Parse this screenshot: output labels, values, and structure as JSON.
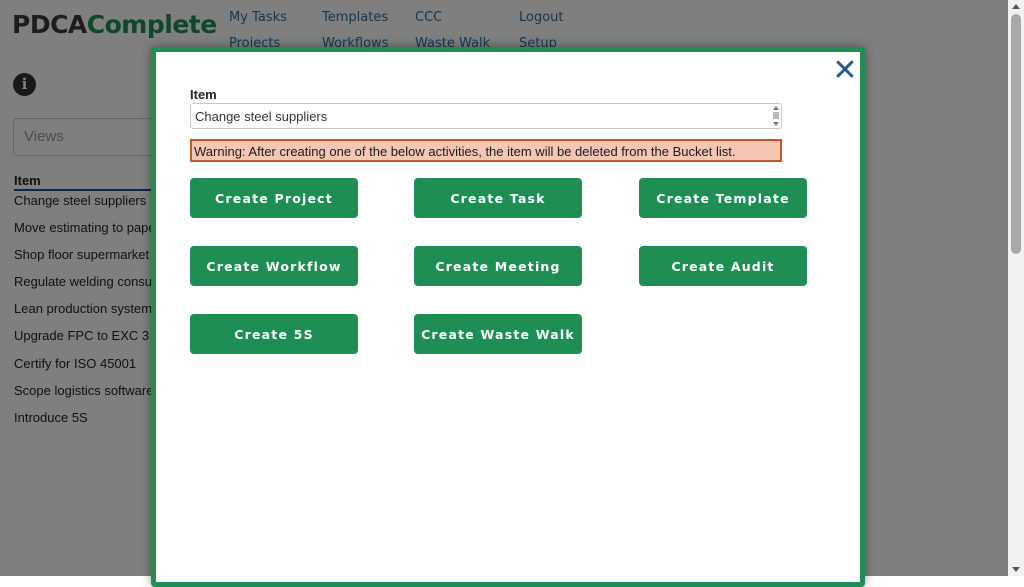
{
  "app": {
    "logo_part1": "PDCA",
    "logo_part2": "Complete"
  },
  "nav": {
    "my_tasks": "My Tasks",
    "templates": "Templates",
    "ccc": "CCC",
    "logout": "Logout",
    "projects": "Projects",
    "workflows": "Workflows",
    "waste_walk": "Waste Walk",
    "setup": "Setup"
  },
  "sidebar": {
    "views_placeholder": "Views",
    "column_header": "Item",
    "items": [
      "Change steel suppliers",
      "Move estimating to paper",
      "Shop floor supermarket",
      "Regulate welding consumables",
      "Lean production system",
      "Upgrade FPC to EXC 3",
      "Certify for ISO 45001",
      "Scope logistics software",
      "Introduce 5S"
    ]
  },
  "modal": {
    "close_symbol": "✕",
    "item_label": "Item",
    "item_value": "Change steel suppliers",
    "warning": "Warning: After creating one of the below activities, the item will be deleted from the Bucket list.",
    "buttons": {
      "project": "Create Project",
      "task": "Create Task",
      "template": "Create Template",
      "workflow": "Create Workflow",
      "meeting": "Create Meeting",
      "audit": "Create Audit",
      "five_s": "Create 5S",
      "waste_walk": "Create Waste Walk"
    }
  },
  "colors": {
    "brand_green": "#1e8e55",
    "nav_blue": "#2a6fa5",
    "warning_bg": "#f5c6b4",
    "warning_border": "#c4582b"
  }
}
